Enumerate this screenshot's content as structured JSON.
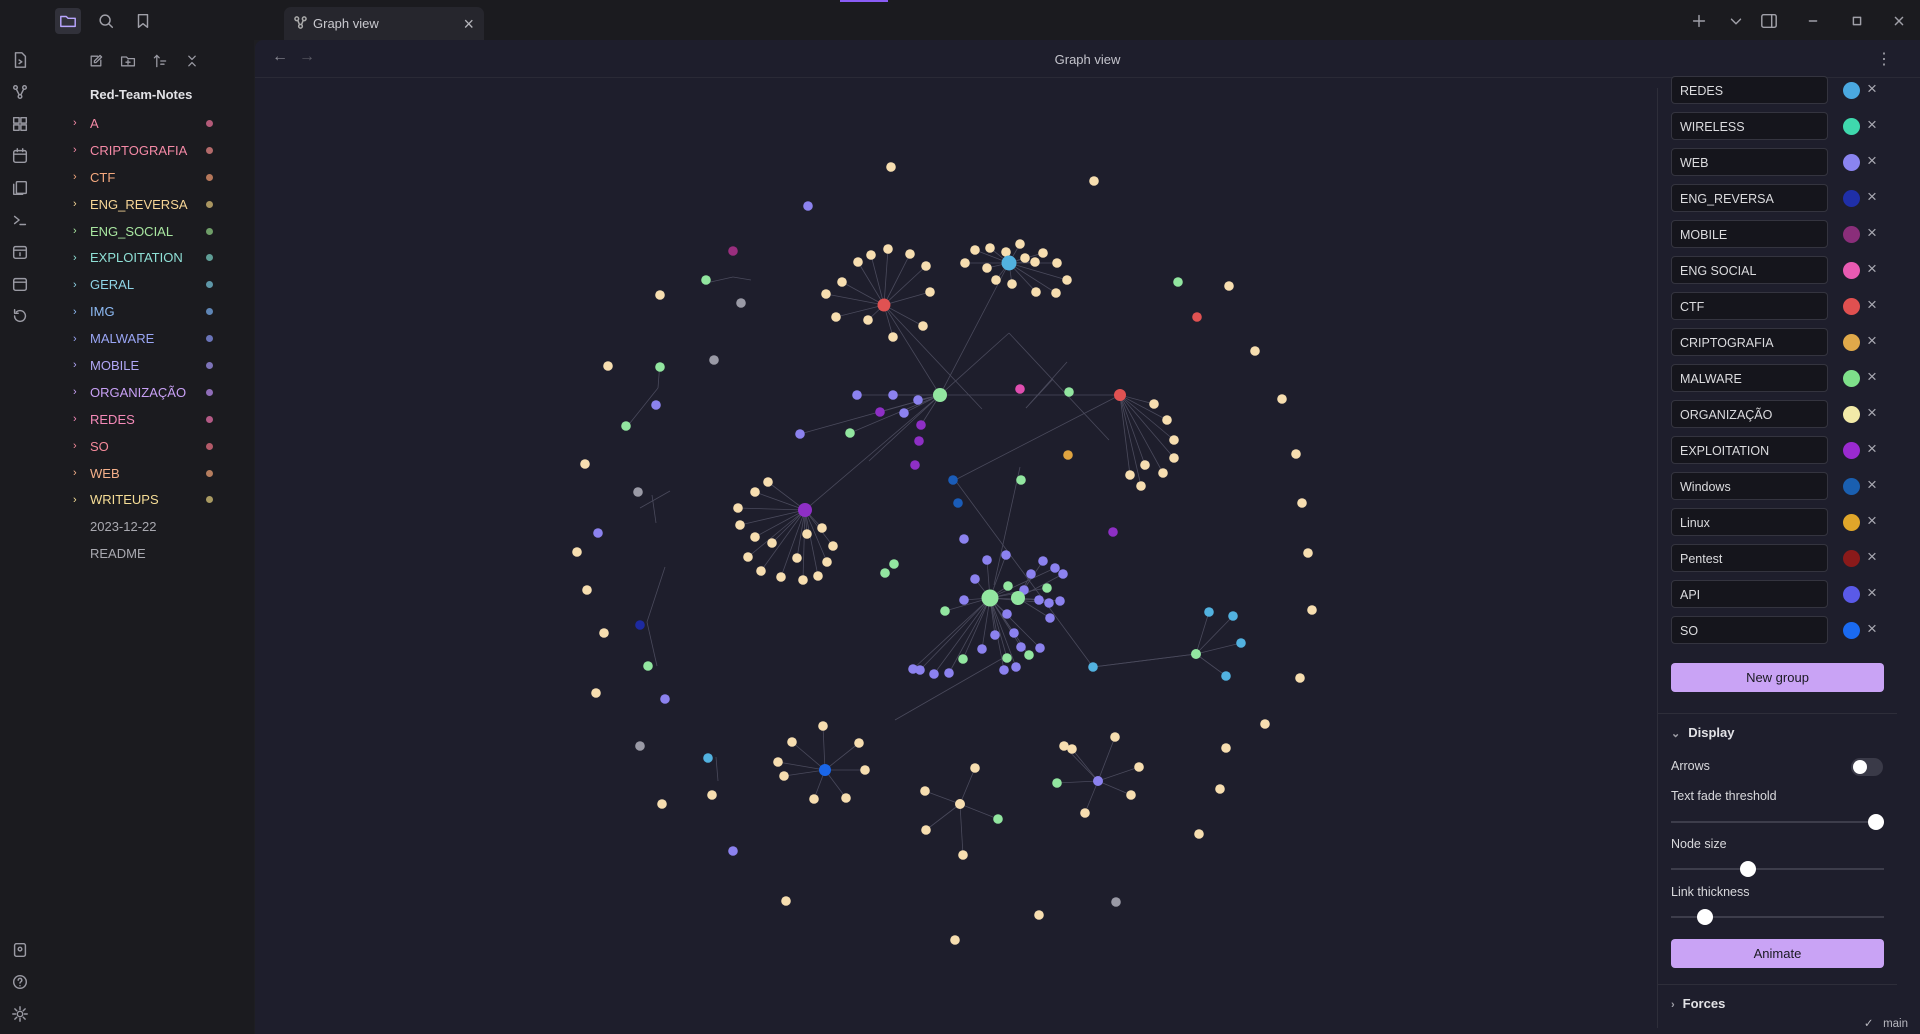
{
  "tab": {
    "label": "Graph view"
  },
  "view": {
    "title": "Graph view"
  },
  "sidebar": {
    "vault_name": "Red-Team-Notes",
    "folders": [
      {
        "label": "A",
        "color": "#f58aa6",
        "dot": "#b35a78"
      },
      {
        "label": "CRIPTOGRAFIA",
        "color": "#f58aa6",
        "dot": "#b36a6a"
      },
      {
        "label": "CTF",
        "color": "#f5a97e",
        "dot": "#b5775a"
      },
      {
        "label": "ENG_REVERSA",
        "color": "#f6d596",
        "dot": "#a99560"
      },
      {
        "label": "ENG_SOCIAL",
        "color": "#a8e6a0",
        "dot": "#6f9e68"
      },
      {
        "label": "EXPLOITATION",
        "color": "#8fe0d6",
        "dot": "#5f9e96"
      },
      {
        "label": "GERAL",
        "color": "#8fd4e6",
        "dot": "#5e97a8"
      },
      {
        "label": "IMG",
        "color": "#8ebbf5",
        "dot": "#5e85b5"
      },
      {
        "label": "MALWARE",
        "color": "#9aa6f5",
        "dot": "#6a74b8"
      },
      {
        "label": "MOBILE",
        "color": "#b0a6f5",
        "dot": "#7d73b8"
      },
      {
        "label": "ORGANIZAÇÃO",
        "color": "#c8a0f5",
        "dot": "#8f6db8"
      },
      {
        "label": "REDES",
        "color": "#f58ab8",
        "dot": "#b35a85"
      },
      {
        "label": "SO",
        "color": "#f58a9a",
        "dot": "#b35a68"
      },
      {
        "label": "WEB",
        "color": "#f5b08a",
        "dot": "#b57d5e"
      },
      {
        "label": "WRITEUPS",
        "color": "#f6dd96",
        "dot": "#a99a62"
      }
    ],
    "files": [
      "2023-12-22",
      "README"
    ]
  },
  "groups": [
    {
      "query": "REDES",
      "color": "#4aa8e0"
    },
    {
      "query": "WIRELESS",
      "color": "#3fd8ad"
    },
    {
      "query": "WEB",
      "color": "#8a84f0"
    },
    {
      "query": "ENG_REVERSA",
      "color": "#1f2fa8"
    },
    {
      "query": "MOBILE",
      "color": "#8a2e7a"
    },
    {
      "query": "ENG SOCIAL",
      "color": "#e85ab2"
    },
    {
      "query": "CTF",
      "color": "#e05050"
    },
    {
      "query": "CRIPTOGRAFIA",
      "color": "#e0a94a"
    },
    {
      "query": "MALWARE",
      "color": "#7ee08a"
    },
    {
      "query": "ORGANIZAÇÃO",
      "color": "#f2eaa8"
    },
    {
      "query": "EXPLOITATION",
      "color": "#9a2ad0"
    },
    {
      "query": "Windows",
      "color": "#1a5fb0"
    },
    {
      "query": "Linux",
      "color": "#e0a62a"
    },
    {
      "query": "Pentest",
      "color": "#8a1a1a"
    },
    {
      "query": "API",
      "color": "#5a5ae8"
    },
    {
      "query": "SO",
      "color": "#1a6af0"
    }
  ],
  "controls": {
    "new_group": "New group",
    "display": "Display",
    "arrows": "Arrows",
    "arrows_on": false,
    "text_fade": "Text fade threshold",
    "text_fade_value": 1.0,
    "node_size": "Node size",
    "node_size_value": 0.35,
    "link_thickness": "Link thickness",
    "link_thickness_value": 0.13,
    "animate": "Animate",
    "forces": "Forces"
  },
  "status": {
    "branch": "main"
  },
  "icons": {
    "ribbon": [
      "sidebar-toggle-icon",
      "open-quick-switcher-icon",
      "graph-view-icon",
      "canvas-icon",
      "daily-note-icon",
      "templates-icon",
      "terminal-icon",
      "calendar-icon",
      "calendar-alt-icon",
      "sync-icon",
      "vault-switcher-icon",
      "help-icon",
      "settings-icon"
    ],
    "sidebar_tools": [
      "new-note-icon",
      "new-folder-icon",
      "sort-icon",
      "collapse-all-icon"
    ]
  }
}
